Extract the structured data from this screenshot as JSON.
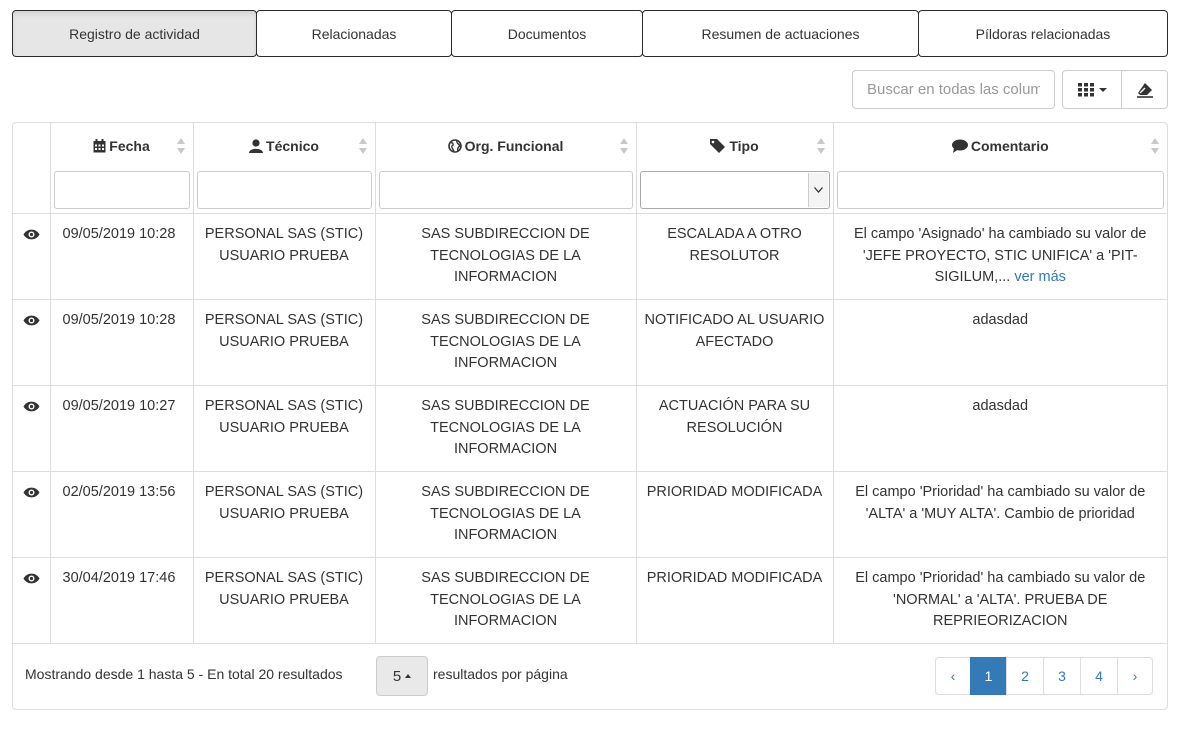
{
  "tabs": [
    {
      "label": "Registro de actividad",
      "active": true
    },
    {
      "label": "Relacionadas",
      "active": false
    },
    {
      "label": "Documentos",
      "active": false
    },
    {
      "label": "Resumen de actuaciones",
      "active": false
    },
    {
      "label": "Píldoras relacionadas",
      "active": false
    }
  ],
  "toolbar": {
    "search_placeholder": "Buscar en todas las columnas",
    "columns_button_icon": "grid-icon",
    "clear_filters_icon": "eraser-icon"
  },
  "table": {
    "columns": [
      {
        "label": "",
        "icon": "none"
      },
      {
        "label": "Fecha",
        "icon": "calendar-icon"
      },
      {
        "label": "Técnico",
        "icon": "user-icon"
      },
      {
        "label": "Org. Funcional",
        "icon": "globe-icon"
      },
      {
        "label": "Tipo",
        "icon": "tag-icon"
      },
      {
        "label": "Comentario",
        "icon": "comment-icon"
      }
    ],
    "rows": [
      {
        "fecha": "09/05/2019 10:28",
        "tecnico": "PERSONAL SAS (STIC) USUARIO PRUEBA",
        "org": "SAS SUBDIRECCION DE TECNOLOGIAS DE LA INFORMACION",
        "tipo": "ESCALADA A OTRO RESOLUTOR",
        "comentario": "El campo 'Asignado' ha cambiado su valor de 'JEFE PROYECTO, STIC UNIFICA' a 'PIT-SIGILUM,...",
        "more": "ver más"
      },
      {
        "fecha": "09/05/2019 10:28",
        "tecnico": "PERSONAL SAS (STIC) USUARIO PRUEBA",
        "org": "SAS SUBDIRECCION DE TECNOLOGIAS DE LA INFORMACION",
        "tipo": "NOTIFICADO AL USUARIO AFECTADO",
        "comentario": "adasdad",
        "more": ""
      },
      {
        "fecha": "09/05/2019 10:27",
        "tecnico": "PERSONAL SAS (STIC) USUARIO PRUEBA",
        "org": "SAS SUBDIRECCION DE TECNOLOGIAS DE LA INFORMACION",
        "tipo": "ACTUACIÓN PARA SU RESOLUCIÓN",
        "comentario": "adasdad",
        "more": ""
      },
      {
        "fecha": "02/05/2019 13:56",
        "tecnico": "PERSONAL SAS (STIC) USUARIO PRUEBA",
        "org": "SAS SUBDIRECCION DE TECNOLOGIAS DE LA INFORMACION",
        "tipo": "PRIORIDAD MODIFICADA",
        "comentario": "El campo 'Prioridad' ha cambiado su valor de 'ALTA' a 'MUY ALTA'. Cambio de prioridad",
        "more": ""
      },
      {
        "fecha": "30/04/2019 17:46",
        "tecnico": "PERSONAL SAS (STIC) USUARIO PRUEBA",
        "org": "SAS SUBDIRECCION DE TECNOLOGIAS DE LA INFORMACION",
        "tipo": "PRIORIDAD MODIFICADA",
        "comentario": "El campo 'Prioridad' ha cambiado su valor de 'NORMAL' a 'ALTA'. PRUEBA DE REPRIEORIZACION",
        "more": ""
      }
    ]
  },
  "footer": {
    "showing": "Mostrando desde 1 hasta 5 - En total 20 resultados",
    "page_size": "5",
    "per_page": "resultados por página",
    "pagination": {
      "prev": "‹",
      "pages": [
        "1",
        "2",
        "3",
        "4"
      ],
      "current": "1",
      "next": "›"
    }
  },
  "colors": {
    "accent": "#337ab7",
    "border": "#dddddd",
    "active_tab": "#e6e6e6"
  }
}
